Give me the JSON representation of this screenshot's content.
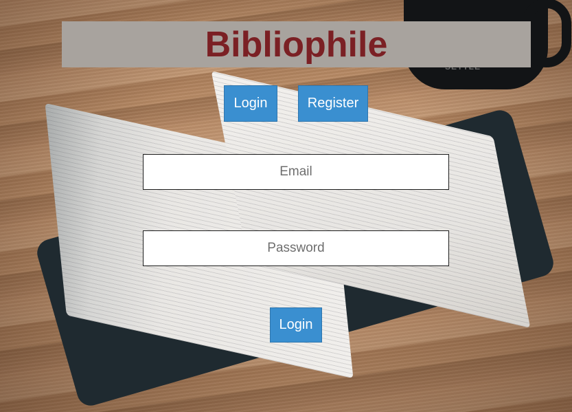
{
  "header": {
    "title": "Bibliophile"
  },
  "nav": {
    "login_label": "Login",
    "register_label": "Register"
  },
  "form": {
    "email_placeholder": "Email",
    "password_placeholder": "Password",
    "submit_label": "Login"
  },
  "background": {
    "mug_text": "SETTLE"
  },
  "colors": {
    "title": "#7b2024",
    "title_bar": "#a8a39e",
    "button": "#3a8fd0",
    "button_text": "#ffffff"
  }
}
